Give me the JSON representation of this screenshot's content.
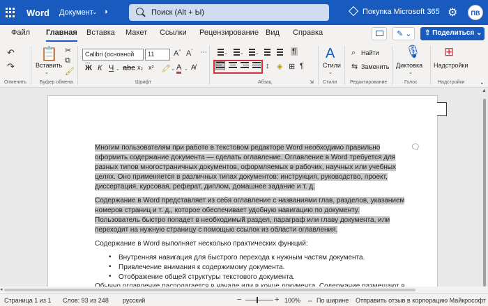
{
  "titlebar": {
    "app_name": "Word",
    "doc_name": "Документ",
    "search_text": "Поиск (Alt + Ы)",
    "buy_label": "Покупка Microsoft 365",
    "avatar": "ПВ"
  },
  "tabs": [
    "Файл",
    "Главная",
    "Вставка",
    "Макет",
    "Ссылки",
    "Рецензирование",
    "Вид",
    "Справка"
  ],
  "active_tab": "Главная",
  "share_label": "Поделиться",
  "ribbon": {
    "paste_label": "Вставить",
    "font_name": "Calibri (основной ...",
    "font_size": "11",
    "styles_label": "Стили",
    "find_label": "Найти",
    "replace_label": "Заменить",
    "dictate_label": "Диктовка",
    "addins_label": "Надстройки",
    "groups": {
      "undo": "Отменить",
      "clipboard": "Буфер обмена",
      "font": "Шрифт",
      "paragraph": "Абзац",
      "styles": "Стили",
      "editing": "Редактирование",
      "voice": "Голос",
      "addins": "Надстройки"
    }
  },
  "document": {
    "para1": [
      "Многим пользователям при работе в текстовом редакторе Word необходимо правильно",
      "оформить содержание документа — сделать оглавление. Оглавление в Word требуется для",
      "разных типов многостраничных документов, оформляемых в рабочих, научных или учебных",
      "целях. Оно применяется в различных типах документов: инструкция, руководство, проект,",
      "диссертация, курсовая, реферат, диплом, домашнее задание и т. д."
    ],
    "para2": [
      "Содержание в Word представляет из себя оглавление с названиями глав, разделов, указанием",
      "номеров страниц и т. д., которое обеспечивает удобную навигацию по документу.",
      "Пользователь быстро попадет в необходимый раздел, параграф или главу документа, или",
      "переходит на нужную страницу с помощью ссылок из области оглавления."
    ],
    "para3": "Содержание в Word выполняет несколько практических функций:",
    "bullets": [
      "Внутренняя навигация для быстрого перехода к нужным частям документа.",
      "Привлечение внимания к содержимому документа.",
      "Отображение общей структуры текстового документа."
    ],
    "para4": "Обычно оглавление располагается в начале или в конце документа. Содержание размещают в"
  },
  "status": {
    "page": "Страница 1 из 1",
    "words": "Слов: 93 из 248",
    "language": "русский",
    "zoom": "100%",
    "fit": "По ширине",
    "feedback": "Отправить отзыв в корпорацию Майкрософт"
  }
}
